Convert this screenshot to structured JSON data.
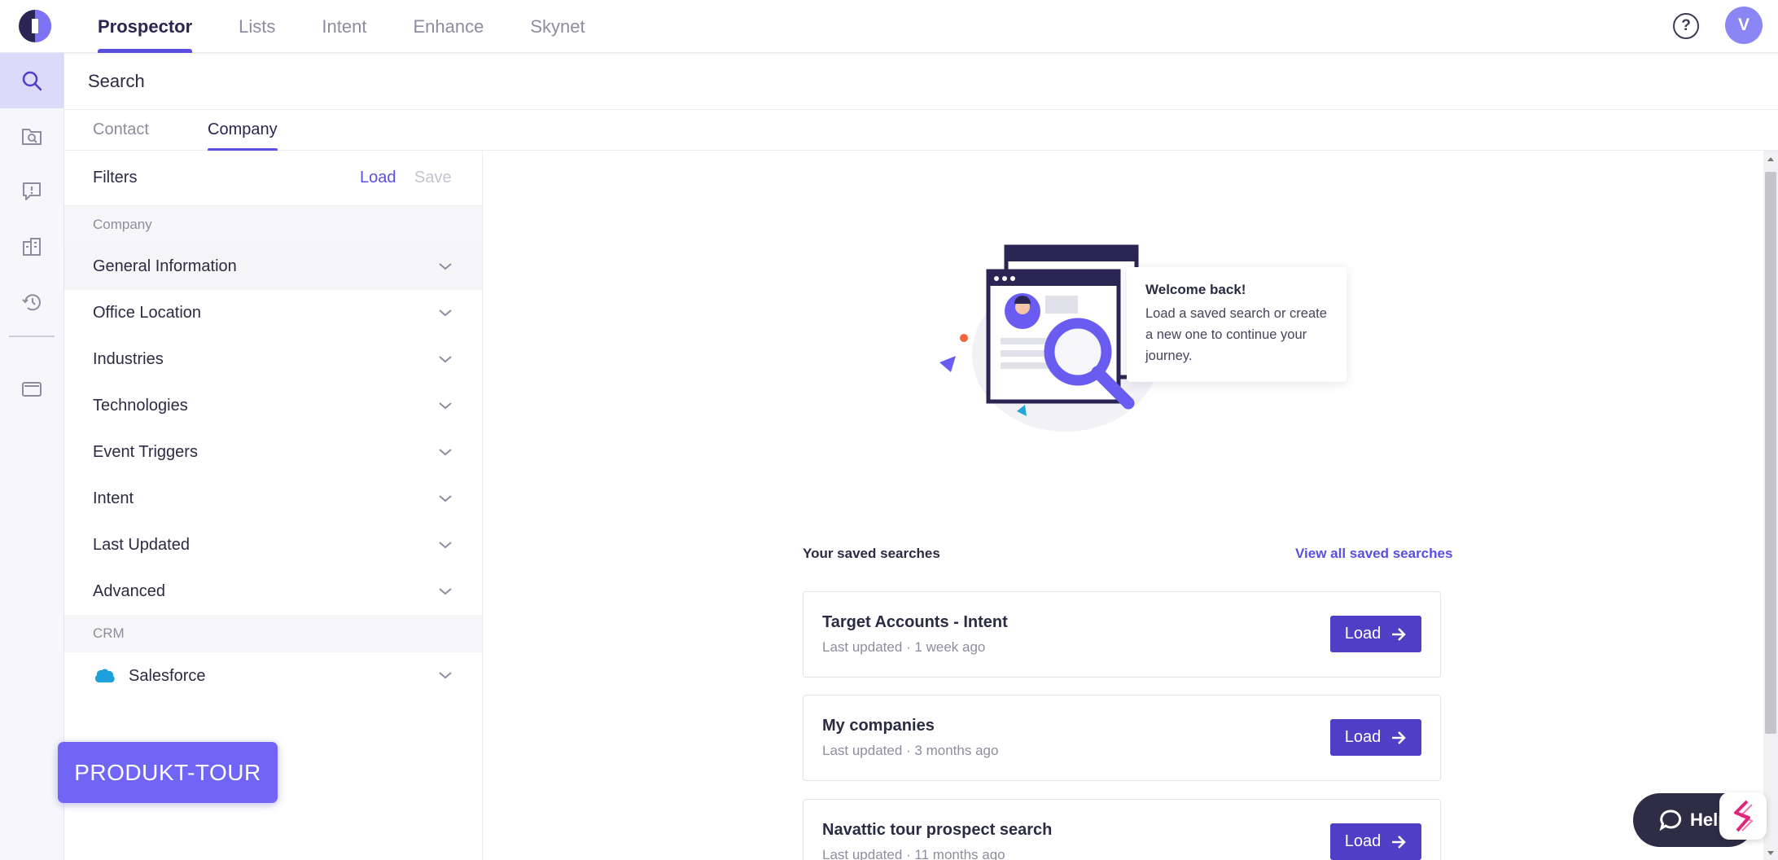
{
  "topnav": {
    "tabs": [
      {
        "label": "Prospector",
        "active": true
      },
      {
        "label": "Lists"
      },
      {
        "label": "Intent"
      },
      {
        "label": "Enhance"
      },
      {
        "label": "Skynet"
      }
    ],
    "help_icon": "question-circle-icon",
    "avatar_initial": "V",
    "brand_color": "#5b4fe0"
  },
  "iconbar": {
    "items": [
      "search-icon",
      "saved-search-icon",
      "alert-icon",
      "company-icon",
      "history-icon",
      "wallet-icon"
    ]
  },
  "search_header": {
    "title": "Search"
  },
  "subtabs": [
    {
      "label": "Contact"
    },
    {
      "label": "Company",
      "active": true
    }
  ],
  "filters": {
    "title": "Filters",
    "load_label": "Load",
    "save_label": "Save",
    "company_section": "Company",
    "company_items": [
      "General Information",
      "Office Location",
      "Industries",
      "Technologies",
      "Event Triggers",
      "Intent",
      "Last Updated",
      "Advanced"
    ],
    "crm_section": "CRM",
    "crm_items": [
      "Salesforce"
    ]
  },
  "welcome": {
    "title": "Welcome back!",
    "text": "Load a saved search or create a new one to continue your journey."
  },
  "saved_searches": {
    "title": "Your saved searches",
    "view_all": "View all saved searches",
    "load_label": "Load",
    "items": [
      {
        "name": "Target Accounts - Intent",
        "meta": "Last updated · 1 week ago"
      },
      {
        "name": "My companies",
        "meta": "Last updated · 3 months ago"
      },
      {
        "name": "Navattic tour prospect search",
        "meta": "Last updated · 11 months ago"
      }
    ]
  },
  "tour_button": "PRODUKT-TOUR",
  "help_widget": {
    "label": "Help"
  }
}
